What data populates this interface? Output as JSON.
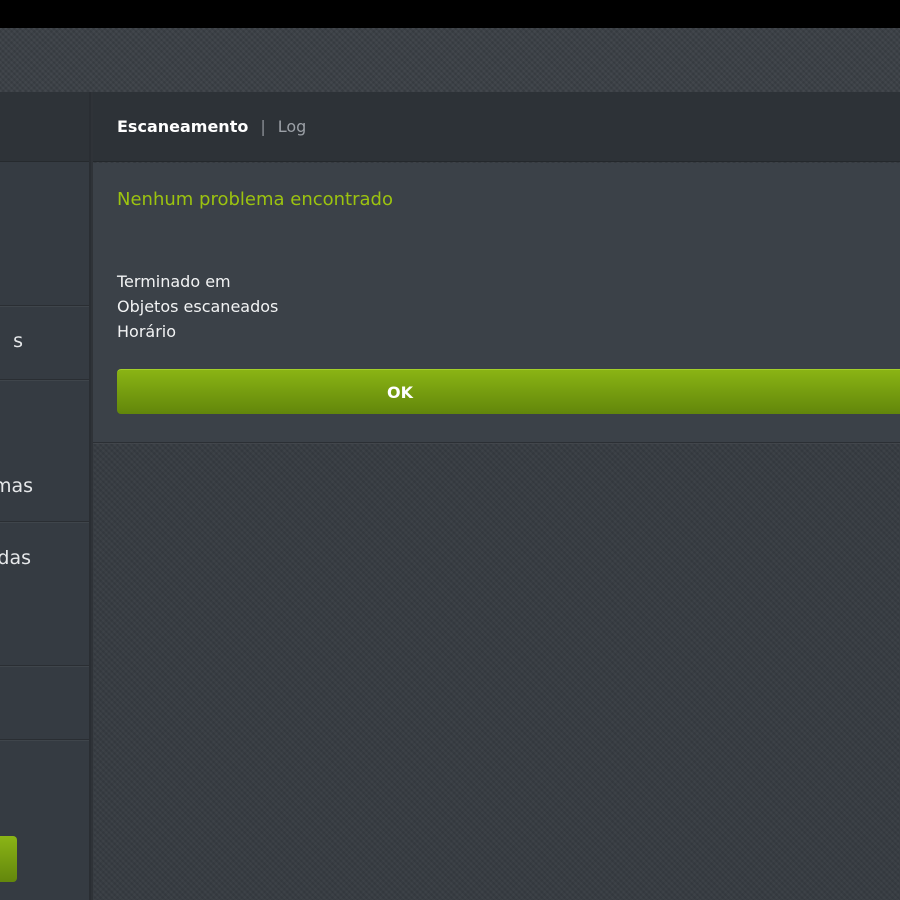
{
  "tabs": {
    "active": "Escaneamento",
    "separator": "|",
    "inactive": "Log"
  },
  "scan_result": {
    "title": "Nenhum problema encontrado",
    "finished_label": "Terminado em",
    "scanned_objects_label": "Objetos escaneados",
    "time_label": "Horário"
  },
  "ok_button": {
    "label": "OK"
  },
  "sidebar": {
    "items": [
      {
        "label": "s"
      },
      {
        "label": "mas"
      },
      {
        "label": "das"
      }
    ]
  },
  "colors": {
    "accent_green": "#9cc30f",
    "button_green": "#7aa111",
    "background": "#363b41"
  }
}
